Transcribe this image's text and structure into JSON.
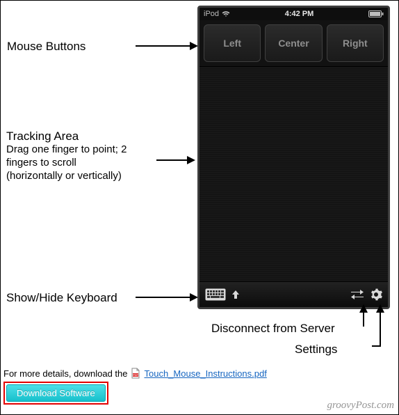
{
  "device": {
    "statusbar": {
      "carrier": "iPod",
      "time": "4:42 PM"
    },
    "mouse_buttons": {
      "left": "Left",
      "center": "Center",
      "right": "Right"
    }
  },
  "labels": {
    "mouse_buttons": "Mouse Buttons",
    "tracking_title": "Tracking Area",
    "tracking_sub1": "Drag one finger to point; 2",
    "tracking_sub2": "fingers to scroll",
    "tracking_sub3": "(horizontally or vertically)",
    "keyboard": "Show/Hide Keyboard",
    "disconnect": "Disconnect from Server",
    "settings": "Settings"
  },
  "details": {
    "prefix": "For more details, download the",
    "link": "Touch_Mouse_Instructions.pdf"
  },
  "download_button": "Download Software",
  "watermark": "groovyPost.com"
}
